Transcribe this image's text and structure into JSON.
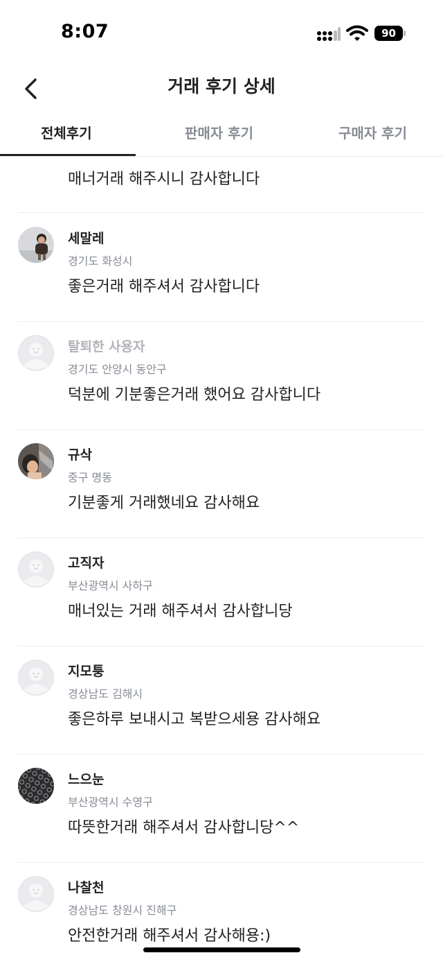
{
  "status_bar": {
    "time": "8:07",
    "battery": "90"
  },
  "header": {
    "title": "거래 후기 상세"
  },
  "tabs": [
    {
      "label": "전체후기",
      "active": true
    },
    {
      "label": "판매자 후기",
      "active": false
    },
    {
      "label": "구매자 후기",
      "active": false
    }
  ],
  "partial_review": {
    "comment": "매너거래 해주시니 감사합니다"
  },
  "reviews": [
    {
      "nickname": "세말레",
      "location": "경기도 화성시",
      "comment": "좋은거래 해주셔서 감사합니다",
      "avatar": "photo-child-icon"
    },
    {
      "nickname": "탈퇴한 사용자",
      "location": "경기도 안양시 동안구",
      "comment": "덕분에 기분좋은거래 했어요 감사합니다",
      "avatar": "default-profile-icon",
      "withdrawn": true
    },
    {
      "nickname": "규삭",
      "location": "중구 명동",
      "comment": "기분좋게 거래했네요 감사해요",
      "avatar": "photo-person-icon"
    },
    {
      "nickname": "고직자",
      "location": "부산광역시 사하구",
      "comment": "매너있는 거래 해주셔서 감사합니당",
      "avatar": "default-profile-icon"
    },
    {
      "nickname": "지모퉁",
      "location": "경상남도 김해시",
      "comment": "좋은하루 보내시고 복받으세용 감사해요",
      "avatar": "default-profile-icon"
    },
    {
      "nickname": "느으눈",
      "location": "부산광역시 수영구",
      "comment": "따뜻한거래 해주셔서 감사합니당^^",
      "avatar": "photo-pattern-icon"
    },
    {
      "nickname": "나찰천",
      "location": "경상남도 창원시 진해구",
      "comment": "안전한거래 해주셔서 감사해용:)",
      "avatar": "default-profile-icon"
    }
  ],
  "colors": {
    "text_primary": "#212124",
    "text_secondary": "#868b94",
    "text_withdrawn": "#b0b3b8",
    "divider": "#e9ecef",
    "default_avatar_bg": "#eaebee"
  }
}
